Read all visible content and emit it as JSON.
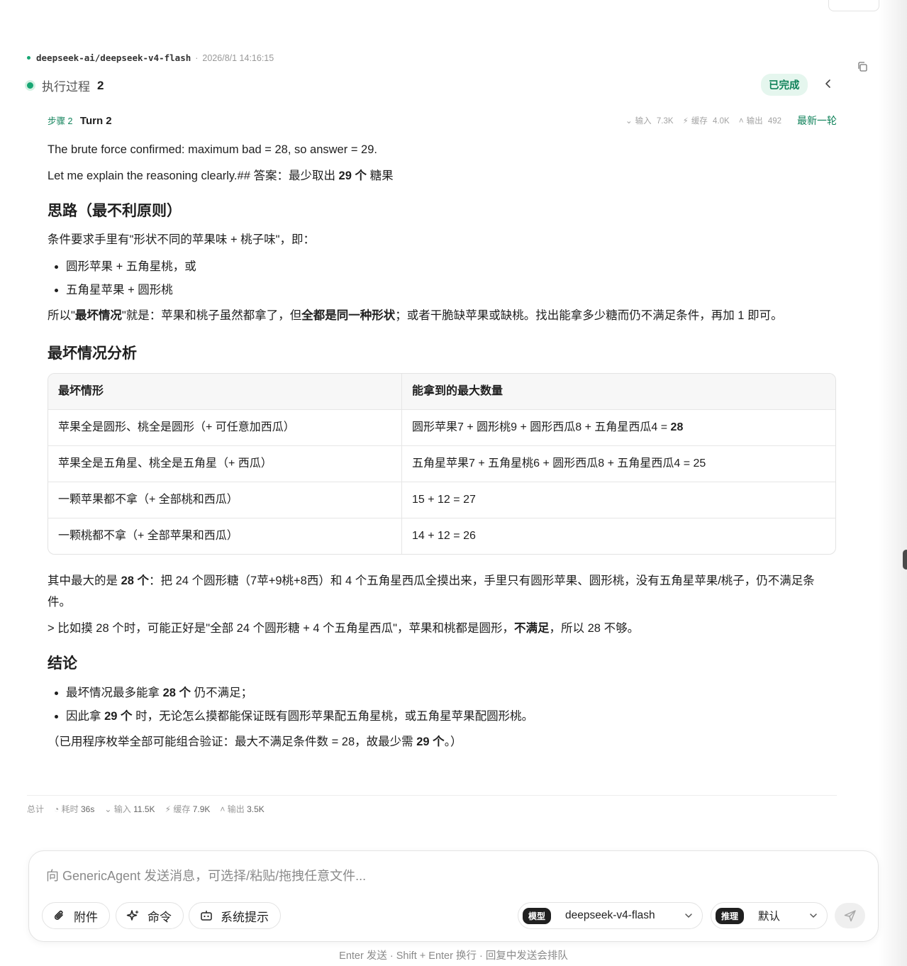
{
  "meta": {
    "model": "deepseek-ai/deepseek-v4-flash",
    "separator": "·",
    "timestamp": "2026/8/1 14:16:15"
  },
  "process": {
    "label": "执行过程",
    "count": "2",
    "status": "已完成"
  },
  "step": {
    "label": "步骤 2",
    "title": "Turn 2",
    "stats": {
      "input_label": "输入",
      "input": "7.3K",
      "cache_label": "缓存",
      "cache": "4.0K",
      "output_label": "输出",
      "output": "492"
    },
    "latest": "最新一轮"
  },
  "content": {
    "p1": "The brute force confirmed: maximum bad = 28, so answer = 29.",
    "p2_a": "Let me explain the reasoning clearly.## 答案：最少取出 ",
    "p2_b": "29 个",
    "p2_c": " 糖果",
    "h_idea": "思路（最不利原则）",
    "p3": "条件要求手里有\"形状不同的苹果味 + 桃子味\"，即：",
    "bullets1": [
      "圆形苹果 + 五角星桃，或",
      "五角星苹果 + 圆形桃"
    ],
    "p4_a": "所以\"",
    "p4_b": "最坏情况",
    "p4_c": "\"就是：苹果和桃子虽然都拿了，但",
    "p4_d": "全都是同一种形状",
    "p4_e": "；或者干脆缺苹果或缺桃。找出能拿多少糖而仍不满足条件，再加 1 即可。",
    "h_worst": "最坏情况分析",
    "table": {
      "headers": [
        "最坏情形",
        "能拿到的最大数量"
      ],
      "rows": [
        {
          "case": "苹果全是圆形、桃全是圆形（+ 可任意加西瓜）",
          "count_a": "圆形苹果7 + 圆形桃9 + 圆形西瓜8 + 五角星西瓜4 = ",
          "count_b": "28"
        },
        {
          "case": "苹果全是五角星、桃全是五角星（+ 西瓜）",
          "count_a": "五角星苹果7 + 五角星桃6 + 圆形西瓜8 + 五角星西瓜4 = 25",
          "count_b": ""
        },
        {
          "case": "一颗苹果都不拿（+ 全部桃和西瓜）",
          "count_a": "15 + 12 = 27",
          "count_b": ""
        },
        {
          "case": "一颗桃都不拿（+ 全部苹果和西瓜）",
          "count_a": "14 + 12 = 26",
          "count_b": ""
        }
      ]
    },
    "p5_a": "其中最大的是 ",
    "p5_b": "28 个",
    "p5_c": "：把 24 个圆形糖（7苹+9桃+8西）和 4 个五角星西瓜全摸出来，手里只有圆形苹果、圆形桃，没有五角星苹果/桃子，仍不满足条件。",
    "p6_a": "> 比如摸 28 个时，可能正好是\"全部 24 个圆形糖 + 4 个五角星西瓜\"，苹果和桃都是圆形，",
    "p6_b": "不满足",
    "p6_c": "，所以 28 不够。",
    "h_conc": "结论",
    "b2_1a": "最坏情况最多能拿 ",
    "b2_1b": "28 个",
    "b2_1c": " 仍不满足；",
    "b2_2a": "因此拿 ",
    "b2_2b": "29 个",
    "b2_2c": " 时，无论怎么摸都能保证既有圆形苹果配五角星桃，或五角星苹果配圆形桃。",
    "p7_a": "（已用程序枚举全部可能组合验证：最大不满足条件数 = 28，故最少需 ",
    "p7_b": "29 个",
    "p7_c": "。）"
  },
  "totals": {
    "label": "总计",
    "time_label": "耗时",
    "time": "36s",
    "input_label": "输入",
    "input": "11.5K",
    "cache_label": "缓存",
    "cache": "7.9K",
    "output_label": "输出",
    "output": "3.5K"
  },
  "composer": {
    "placeholder": "向 GenericAgent 发送消息，可选择/粘贴/拖拽任意文件...",
    "attach": "附件",
    "command": "命令",
    "system_prompt": "系统提示",
    "model_tag": "模型",
    "model_value": "deepseek-v4-flash",
    "reason_tag": "推理",
    "reason_value": "默认"
  },
  "hint": "Enter 发送 · Shift + Enter 换行 · 回复中发送会排队"
}
